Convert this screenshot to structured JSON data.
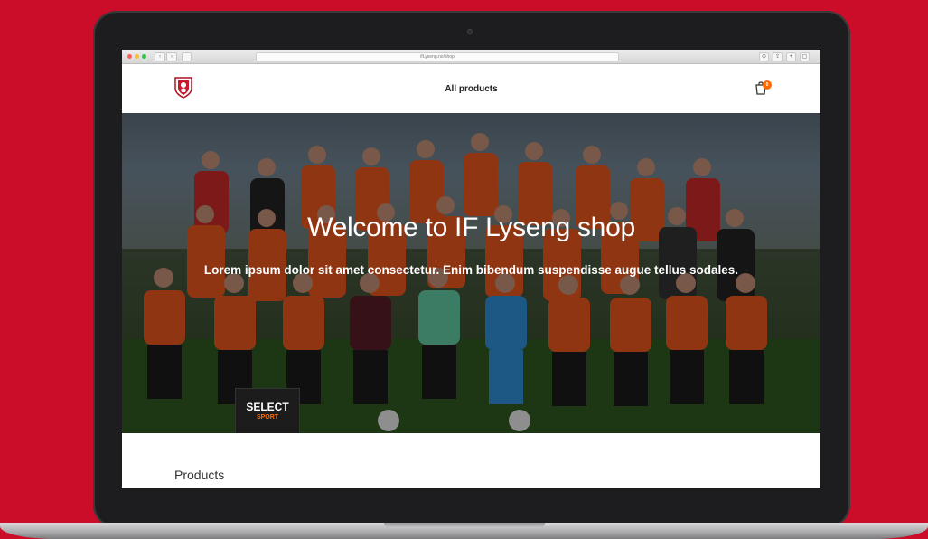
{
  "browser": {
    "address": "ifLyseng.no/shop",
    "controls": [
      "‹",
      "›"
    ]
  },
  "header": {
    "nav_label": "All products",
    "cart_count": "0"
  },
  "hero": {
    "title": "Welcome to IF Lyseng shop",
    "subtitle": "Lorem ipsum dolor sit amet consectetur. Enim bibendum suspendisse augue tellus sodales.",
    "sign_text": "SELECT",
    "sign_subtext": "SPORT"
  },
  "products": {
    "heading": "Products"
  },
  "colors": {
    "background": "#cc0d2a",
    "jersey": "#e8561d",
    "badge": "#ff6a00",
    "goalkeeper_green": "#62c9a3",
    "goalkeeper_blue": "#2f8fd6",
    "maroon": "#5a1c28"
  }
}
